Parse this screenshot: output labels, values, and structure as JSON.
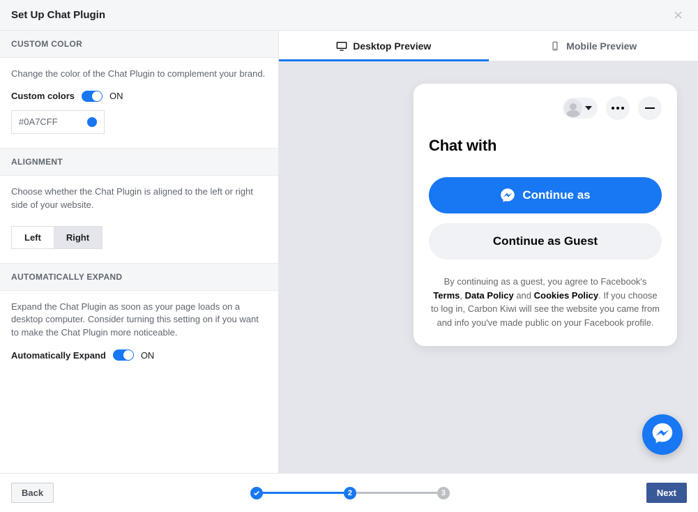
{
  "header": {
    "title": "Set Up Chat Plugin"
  },
  "sidebar": {
    "custom_color": {
      "heading": "CUSTOM COLOR",
      "description": "Change the color of the Chat Plugin to complement your brand.",
      "toggle_label": "Custom colors",
      "toggle_state": "ON",
      "value": "#0A7CFF",
      "swatch_hex": "#1877f2"
    },
    "alignment": {
      "heading": "ALIGNMENT",
      "description": "Choose whether the Chat Plugin is aligned to the left or right side of your website.",
      "options": [
        "Left",
        "Right"
      ],
      "selected": "Right"
    },
    "auto_expand": {
      "heading": "AUTOMATICALLY EXPAND",
      "description": "Expand the Chat Plugin as soon as your page loads on a desktop computer. Consider turning this setting on if you want to make the Chat Plugin more noticeable.",
      "toggle_label": "Automatically Expand",
      "toggle_state": "ON"
    }
  },
  "preview": {
    "tabs": {
      "desktop": "Desktop Preview",
      "mobile": "Mobile Preview",
      "active": "desktop"
    },
    "chat": {
      "title_prefix": "Chat with ",
      "continue_label": "Continue as ",
      "guest_label": "Continue as Guest",
      "fineprint_before": "By continuing as a guest, you agree to Facebook's ",
      "terms": "Terms",
      "comma": ", ",
      "data_policy": "Data Policy",
      "and": " and ",
      "cookies_policy": "Cookies Policy",
      "fineprint_after": ". If you choose to log in, Carbon Kiwi will see the website you came from and info you've made public on your Facebook profile."
    }
  },
  "footer": {
    "back": "Back",
    "next": "Next",
    "steps": {
      "2": "2",
      "3": "3"
    }
  }
}
